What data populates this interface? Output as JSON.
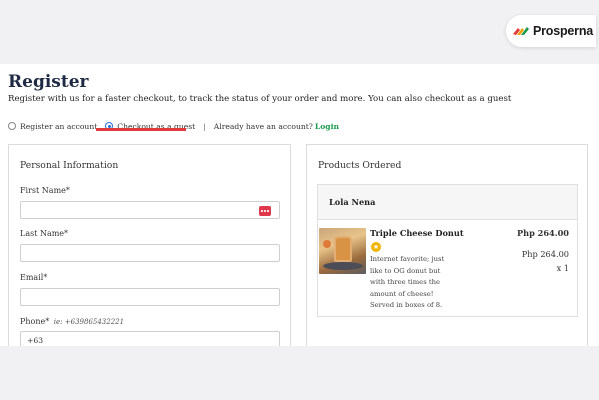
{
  "brand": {
    "name": "Prosperna"
  },
  "header": {
    "title": "Register",
    "subtitle": "Register with us for a faster checkout, to track the status of your order and more. You can also checkout as a guest"
  },
  "options": {
    "register": "Register an account",
    "guest": "Checkout as a guest",
    "separator": "|",
    "account_prompt": "Already have an account?",
    "login": "Login",
    "selected": "guest"
  },
  "personal": {
    "title": "Personal Information",
    "first_name_label": "First Name*",
    "first_name_value": "",
    "last_name_label": "Last Name*",
    "last_name_value": "",
    "email_label": "Email*",
    "email_value": "",
    "phone_label": "Phone*",
    "phone_hint": "ie: +639865432221",
    "phone_value": "+63"
  },
  "products": {
    "title": "Products Ordered",
    "store": "Lola Nena",
    "item": {
      "name": "Triple Cheese Donut",
      "description": "Internet favorite; just like to OG donut but with three times the amount of cheese! Served in boxes of 8.",
      "price": "Php 264.00",
      "subtotal": "Php 264.00",
      "qty": "x 1"
    }
  },
  "colors": {
    "accent": "#e23a3a",
    "link": "#1a9a4a",
    "title": "#1f2a44",
    "radio": "#2a6fd6"
  }
}
